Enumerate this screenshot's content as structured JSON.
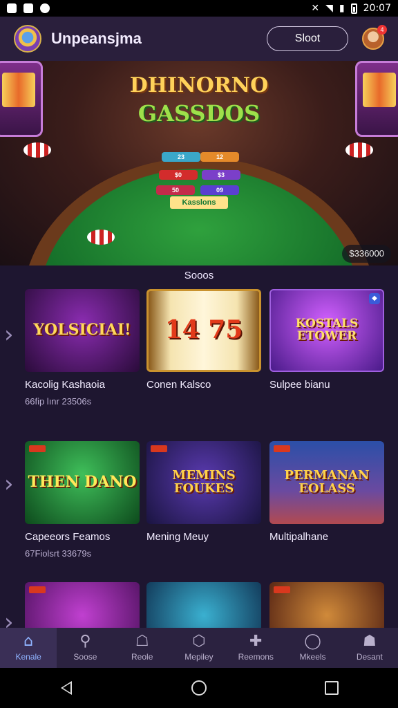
{
  "status_bar": {
    "time": "20:07",
    "signal_icon": "signal-icon",
    "wifi_icon": "wifi-icon",
    "battery_icon": "battery-icon"
  },
  "header": {
    "app_title": "Unpeansjma",
    "start_label": "Sloot",
    "avatar_badge": "4"
  },
  "hero": {
    "title_line1": "DHINORNO",
    "title_line2": "GASSDOS",
    "felt_sign": "Kasslons",
    "jackpot": "$336000",
    "bets": [
      "23",
      "12",
      "$0",
      "$3",
      "50",
      "09"
    ]
  },
  "section": {
    "title": "Sooos"
  },
  "rows": [
    [
      {
        "art": "YOLSICIAI!",
        "name": "Kacolig Kashaoia",
        "meta": "66fip lınr 23506s"
      },
      {
        "art": "14 75",
        "name": "Conen Kalsco",
        "meta": ""
      },
      {
        "art": "KOSTALS ETOWER",
        "name": "Sulpee bianu",
        "meta": ""
      }
    ],
    [
      {
        "art": "THEN DANO",
        "name": "Capeeors Feamos",
        "meta": "67Fiolsrt 33679s"
      },
      {
        "art": "MEMINS FOUKES",
        "name": "Mening Meuy",
        "meta": ""
      },
      {
        "art": "PERMANAN EOLASS",
        "name": "Multipalhane",
        "meta": ""
      }
    ],
    [
      {
        "art": "",
        "name": "",
        "meta": ""
      },
      {
        "art": "",
        "name": "",
        "meta": ""
      },
      {
        "art": "",
        "name": "",
        "meta": ""
      }
    ]
  ],
  "bottom_nav": [
    {
      "label": "Kenale",
      "icon": "home-icon",
      "active": true
    },
    {
      "label": "Soose",
      "icon": "search-icon",
      "active": false
    },
    {
      "label": "Reole",
      "icon": "bell-icon",
      "active": false
    },
    {
      "label": "Mepiley",
      "icon": "cube-icon",
      "active": false
    },
    {
      "label": "Reemons",
      "icon": "puzzle-icon",
      "active": false
    },
    {
      "label": "Mkeels",
      "icon": "chat-icon",
      "active": false
    },
    {
      "label": "Desant",
      "icon": "profile-icon",
      "active": false
    }
  ],
  "colors": {
    "background": "#1e1630",
    "header": "#2a1f3c",
    "nav": "#2b2240",
    "accent": "#8fb3ff"
  }
}
